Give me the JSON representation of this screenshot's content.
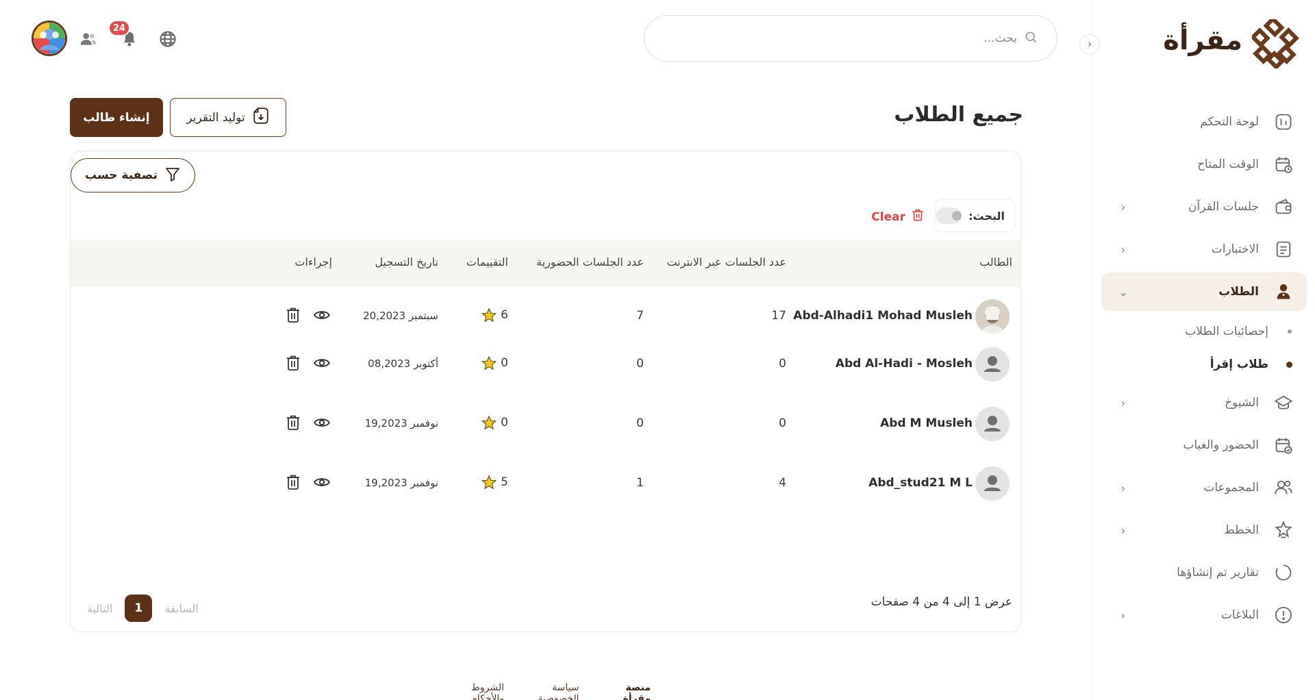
{
  "brand": {
    "name": "مقرأة"
  },
  "topbar": {
    "search_placeholder": "بحث...",
    "notifications_count": "24"
  },
  "sidebar": {
    "items": [
      {
        "label": "لوحة التحكم",
        "icon": "dashboard-icon",
        "has_children": false
      },
      {
        "label": "الوقت المتاح",
        "icon": "calendar-clock-icon",
        "has_children": false
      },
      {
        "label": "جلسات القرآن",
        "icon": "wallet-icon",
        "has_children": true
      },
      {
        "label": "الاختبارات",
        "icon": "document-icon",
        "has_children": true
      },
      {
        "label": "الطلاب",
        "icon": "student-icon",
        "has_children": true,
        "active": true
      },
      {
        "label": "الشيوخ",
        "icon": "graduation-cap-icon",
        "has_children": true
      },
      {
        "label": "الحضور والغياب",
        "icon": "calendar-check-icon",
        "has_children": false
      },
      {
        "label": "المجموعات",
        "icon": "users-icon",
        "has_children": true
      },
      {
        "label": "الخطط",
        "icon": "star-badge-icon",
        "has_children": true
      },
      {
        "label": "تقارير تم إنشاؤها",
        "icon": "circle-dashed-icon",
        "has_children": false
      },
      {
        "label": "البلاغات",
        "icon": "alert-circle-icon",
        "has_children": true
      }
    ],
    "subitems": [
      {
        "label": "إحصائيات الطلاب",
        "active": false
      },
      {
        "label": "طلاب إقرأ",
        "active": true
      }
    ]
  },
  "page": {
    "title": "جميع الطلاب",
    "create_button": "إنشاء طالب",
    "report_button": "توليد التقرير",
    "filter_button": "تصفية حسب",
    "search_label": "البحث:",
    "clear_label": "Clear"
  },
  "table": {
    "headers": {
      "student": "الطالب",
      "online_sessions": "عدد الجلسات عبر الانترنت",
      "attendance_sessions": "عدد الجلسات الحضورية",
      "ratings": "التقييمات",
      "registration_date": "تاريخ التسجيل",
      "actions": "إجراءات"
    },
    "rows": [
      {
        "name": "Abd-Alhadi1 Mohad Musleh",
        "online": "17",
        "attendance": "7",
        "rating": "6",
        "date": "سبتمبر 20,2023",
        "has_photo": true
      },
      {
        "name": "Abd Al-Hadi - Mosleh",
        "online": "0",
        "attendance": "0",
        "rating": "0",
        "date": "أكتوبر 08,2023",
        "has_photo": false
      },
      {
        "name": "Abd M Musleh",
        "online": "0",
        "attendance": "0",
        "rating": "0",
        "date": "نوفمبر 19,2023",
        "has_photo": false
      },
      {
        "name": "Abd_stud21 M L",
        "online": "4",
        "attendance": "1",
        "rating": "5",
        "date": "نوفمبر 19,2023",
        "has_photo": false
      }
    ]
  },
  "pagination": {
    "info": "عرض 1 إلى 4 من 4 صفحات",
    "previous": "السابقة",
    "next": "التالية",
    "current": "1"
  },
  "footer": {
    "brand": "منصة مقرأة",
    "privacy": "سياسة الخصوصية",
    "terms": "الشروط والأحكام"
  },
  "colors": {
    "primary": "#5d3116",
    "accent_bg": "#f6efe7",
    "danger": "#e04848",
    "star": "#f3c623"
  }
}
